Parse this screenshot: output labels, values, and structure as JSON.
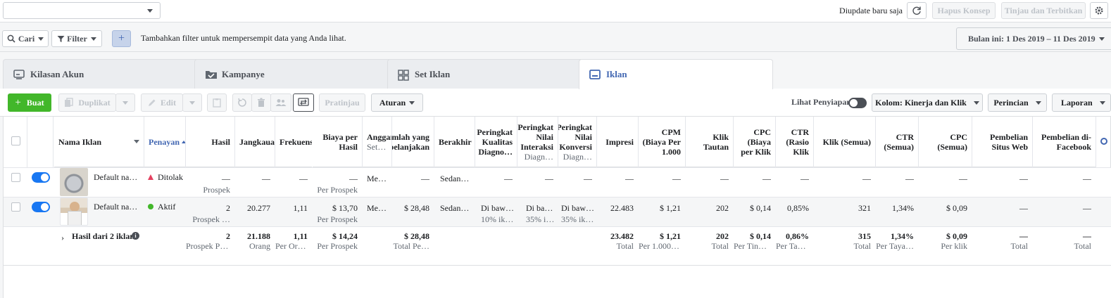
{
  "topbar": {
    "account_value": "",
    "updated_text": "Diupdate baru saja",
    "discard_label": "Hapus Konsep",
    "review_publish_label": "Tinjau dan Terbitkan"
  },
  "filterbar": {
    "search_label": "Cari",
    "filter_label": "Filter",
    "plus_label": "+",
    "hint": "Tambahkan filter untuk mempersempit data yang Anda lihat.",
    "date_range": "Bulan ini: 1 Des 2019 – 11 Des 2019"
  },
  "tabs": [
    {
      "label": "Kilasan Akun",
      "icon": "account-overview-icon"
    },
    {
      "label": "Kampanye",
      "icon": "folder-icon"
    },
    {
      "label": "Set Iklan",
      "icon": "grid-icon"
    },
    {
      "label": "Iklan",
      "icon": "ad-icon",
      "active": true
    }
  ],
  "toolbar": {
    "create_label": "Buat",
    "duplicate_label": "Duplikat",
    "edit_label": "Edit",
    "preview_label": "Pratinjau",
    "rules_label": "Aturan",
    "view_setup_label": "Lihat Penyiapan",
    "columns_label": "Kolom: Kinerja dan Klik",
    "breakdown_label": "Perincian",
    "reports_label": "Laporan"
  },
  "table": {
    "headers": {
      "name": "Nama Iklan",
      "delivery": "Penayan",
      "results": "Hasil",
      "reach": "Jangkauan",
      "frequency": "Frekuensi",
      "cost_per_result_1": "Biaya per",
      "cost_per_result_2": "Hasil",
      "budget_1": "Anggaran",
      "budget_2": "Set…",
      "amount_spent_1": "Jumlah yang",
      "amount_spent_2": "Dibelanjakan",
      "ends": "Berakhir",
      "quality_1": "Peringkat",
      "quality_2": "Kualitas",
      "quality_3": "Diagno…",
      "engagement_1": "Peringkat",
      "engagement_2": "Nilai",
      "engagement_3": "Interaksi",
      "engagement_4": "Diagn…",
      "conversion_1": "Peringkat",
      "conversion_2": "Nilai",
      "conversion_3": "Konversi",
      "conversion_4": "Diagn…",
      "impressions": "Impresi",
      "cpm_1": "CPM",
      "cpm_2": "(Biaya Per",
      "cpm_3": "1.000",
      "link_clicks_1": "Klik",
      "link_clicks_2": "Tautan",
      "cpc_1": "CPC",
      "cpc_2": "(Biaya",
      "cpc_3": "per Klik",
      "ctr_1": "CTR",
      "ctr_2": "(Rasio",
      "ctr_3": "Klik",
      "clicks_all": "Klik (Semua)",
      "ctr_all_1": "CTR",
      "ctr_all_2": "(Semua)",
      "cpc_all_1": "CPC",
      "cpc_all_2": "(Semua)",
      "web_purchases_1": "Pembelian",
      "web_purchases_2": "Situs Web",
      "fb_purchases_1": "Pembelian di-",
      "fb_purchases_2": "Facebook"
    },
    "rows": [
      {
        "name": "Default na…",
        "delivery": "Ditolak",
        "delivery_status": "rejected",
        "toggle": "on",
        "results": "—",
        "results_sub": "Prospek",
        "reach": "—",
        "frequency": "—",
        "cost_per_result": "—",
        "cost_per_result_sub": "Per Prospek",
        "budget": "Me…",
        "amount_spent": "—",
        "ends": "Sedan…",
        "quality": "—",
        "quality_sub": "",
        "engagement": "—",
        "engagement_sub": "",
        "conversion": "—",
        "conversion_sub": "",
        "impressions": "—",
        "cpm": "—",
        "link_clicks": "—",
        "cpc": "—",
        "ctr": "—",
        "clicks_all": "—",
        "ctr_all": "—",
        "cpc_all": "—",
        "web_purchases": "—",
        "fb_purchases": "—"
      },
      {
        "name": "Default na…",
        "delivery": "Aktif",
        "delivery_status": "active",
        "toggle": "on",
        "results": "2",
        "results_sub": "Prospek …",
        "reach": "20.277",
        "frequency": "1,11",
        "cost_per_result": "$ 13,70",
        "cost_per_result_sub": "Per Prospek",
        "budget": "Me…",
        "amount_spent": "$ 28,48",
        "ends": "Sedan…",
        "quality": "Di baw…",
        "quality_sub": "10% ik…",
        "engagement": "Di ba…",
        "engagement_sub": "35% i…",
        "conversion": "Di baw…",
        "conversion_sub": "35% ik…",
        "impressions": "22.483",
        "cpm": "$ 1,21",
        "link_clicks": "202",
        "cpc": "$ 0,14",
        "ctr": "0,85%",
        "clicks_all": "321",
        "ctr_all": "1,34%",
        "cpc_all": "$ 0,09",
        "web_purchases": "—",
        "fb_purchases": "—"
      }
    ],
    "totals": {
      "label": "Hasil dari 2 iklan",
      "results": "2",
      "results_sub": "Prospek Pe…",
      "reach": "21.188",
      "reach_sub": "Orang",
      "frequency": "1,11",
      "frequency_sub": "Per Orang",
      "cost_per_result": "$ 14,24",
      "cost_per_result_sub": "Per Prospek",
      "amount_spent": "$ 28,48",
      "amount_spent_sub": "Total Pe…",
      "impressions": "23.482",
      "impressions_sub": "Total",
      "cpm": "$ 1,21",
      "cpm_sub": "Per 1.000 …",
      "link_clicks": "202",
      "link_clicks_sub": "Total",
      "cpc": "$ 0,14",
      "cpc_sub": "Per Tind…",
      "ctr": "0,86%",
      "ctr_sub": "Per Tay…",
      "clicks_all": "315",
      "clicks_all_sub": "Total",
      "ctr_all": "1,34%",
      "ctr_all_sub": "Per Taya…",
      "cpc_all": "$ 0,09",
      "cpc_all_sub": "Per klik",
      "web_purchases": "—",
      "web_purchases_sub": "Total",
      "fb_purchases": "—",
      "fb_purchases_sub": "Total"
    }
  },
  "colors": {
    "primary_blue": "#4267b2",
    "create_green": "#42b72a",
    "toggle_blue": "#1877f2",
    "rejected_red": "#e4405f",
    "active_green": "#42b72a"
  }
}
